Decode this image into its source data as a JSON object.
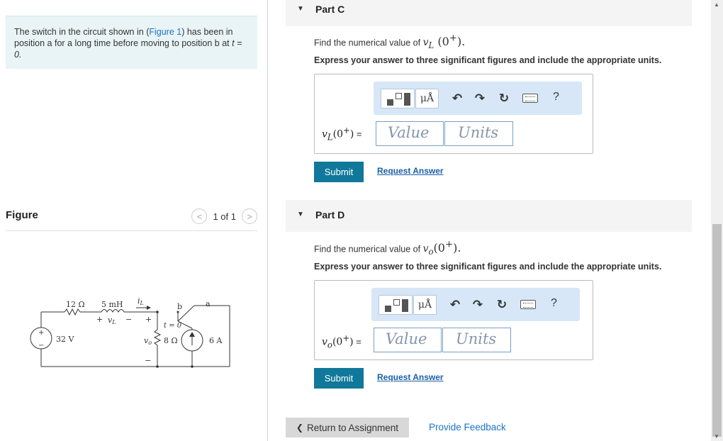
{
  "problem": {
    "text_before": "The switch in the circuit shown in (",
    "figure_link": "Figure 1",
    "text_after": ") has been in position a for a long time before moving to position b at ",
    "t_eq": "t = 0."
  },
  "figure": {
    "title": "Figure",
    "pager": "1 of 1",
    "prev": "<",
    "next": ">",
    "circuit": {
      "r1": "12 Ω",
      "l": "5 mH",
      "il": "i",
      "il_sub": "L",
      "vl_plus": "+",
      "vl": "v",
      "vl_sub": "L",
      "vl_minus": "−",
      "b": "b",
      "a": "a",
      "t0": "t = 0",
      "src_plus": "+",
      "src_minus": "−",
      "v_src": "32 V",
      "vo_plus": "+",
      "vo": "v",
      "vo_sub": "o",
      "vo_minus": "−",
      "r2": "8 Ω",
      "i_src": "6 A"
    }
  },
  "parts": [
    {
      "label": "Part C",
      "question_prefix": "Find the numerical value of ",
      "var": "v",
      "var_sub": "L",
      "arg_open": "(",
      "arg": "0",
      "arg_sup": "+",
      "arg_close": ").",
      "instruction": "Express your answer to three significant figures and include the appropriate units.",
      "eq_var": "v",
      "eq_sub": "L",
      "eq_arg": "(0",
      "eq_sup": "+",
      "eq_close": ")",
      "eq_sign": " =",
      "value_placeholder": "Value",
      "units_placeholder": "Units",
      "submit": "Submit",
      "request": "Request Answer"
    },
    {
      "label": "Part D",
      "question_prefix": "Find the numerical value of ",
      "var": "v",
      "var_sub": "o",
      "arg_open": "(",
      "arg": "0",
      "arg_sup": "+",
      "arg_close": ").",
      "instruction": "Express your answer to three significant figures and include the appropriate units.",
      "eq_var": "v",
      "eq_sub": "o",
      "eq_arg": "(0",
      "eq_sup": "+",
      "eq_close": ")",
      "eq_sign": " =",
      "value_placeholder": "Value",
      "units_placeholder": "Units",
      "submit": "Submit",
      "request": "Request Answer"
    }
  ],
  "toolbar": {
    "mu_label": "μÅ",
    "help": "?"
  },
  "footer": {
    "return": "Return to Assignment",
    "return_chevron": "❮",
    "feedback": "Provide Feedback"
  },
  "colors": {
    "accent": "#10789a",
    "link": "#1a73c7",
    "problem_bg": "#e9f4f6",
    "toolbar_bg": "#d7e7f7"
  }
}
